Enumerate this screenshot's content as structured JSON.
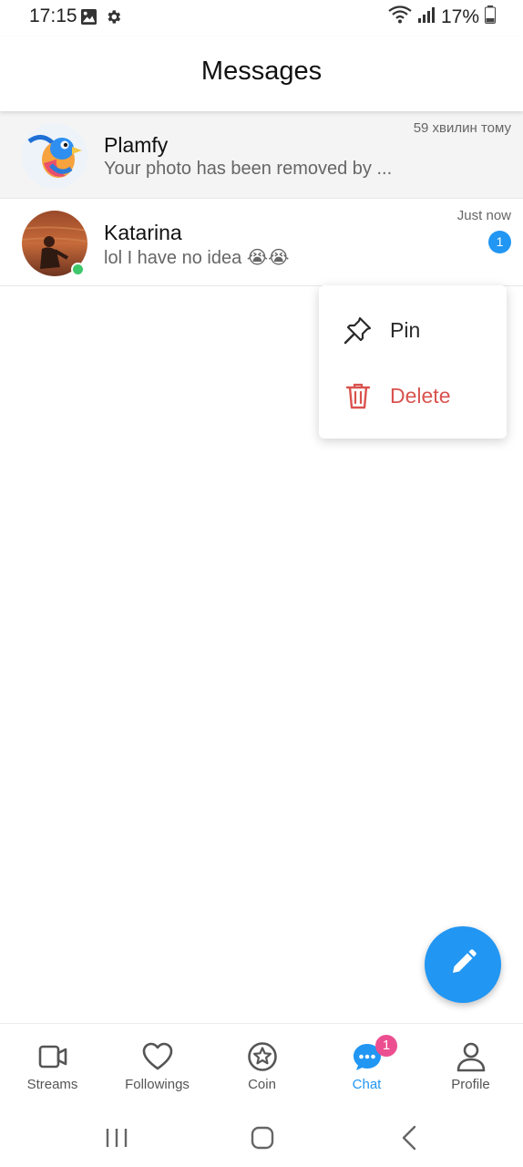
{
  "status": {
    "time": "17:15",
    "battery": "17%"
  },
  "header": {
    "title": "Messages"
  },
  "conversations": [
    {
      "name": "Plamfy",
      "preview": "Your photo has been removed by ...",
      "time": "59 хвилин тому",
      "avatar_icon": "plamfy-bird-logo"
    },
    {
      "name": "Katarina",
      "preview": "lol I have no idea 😭😭",
      "time": "Just now",
      "unread": "1",
      "online": true
    }
  ],
  "context_menu": {
    "pin_label": "Pin",
    "delete_label": "Delete"
  },
  "bottom_nav": {
    "items": [
      {
        "label": "Streams",
        "icon": "video-camera-icon"
      },
      {
        "label": "Followings",
        "icon": "heart-icon"
      },
      {
        "label": "Coin",
        "icon": "star-coin-icon"
      },
      {
        "label": "Chat",
        "icon": "chat-bubble-icon",
        "badge": "1",
        "active": true
      },
      {
        "label": "Profile",
        "icon": "person-icon"
      }
    ]
  },
  "colors": {
    "accent": "#2196f3",
    "delete": "#d9534f",
    "badge": "#ec4f8f",
    "online": "#3fc76b"
  }
}
